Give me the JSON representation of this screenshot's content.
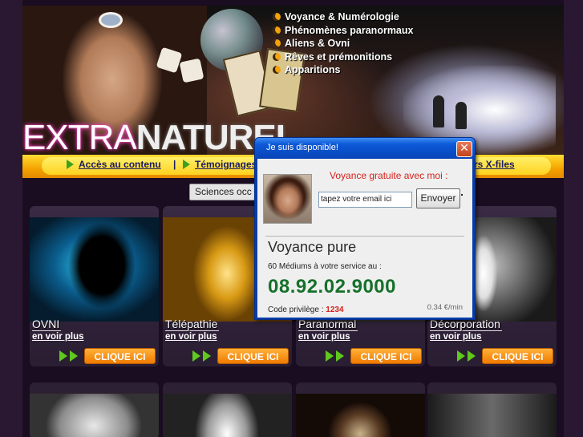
{
  "header": {
    "menu": [
      "Voyance & Numérologie",
      "Phénomènes paranormaux",
      "Aliens & Ovni",
      "Rêves et prémonitions",
      "Apparitions"
    ],
    "logo_part1": "EXTRA",
    "logo_part2": "NATUREL"
  },
  "nav": {
    "items": [
      "Accès au contenu",
      "Témoignages",
      "rs X-files"
    ],
    "separator": "|"
  },
  "category_select": {
    "value": "Sciences occ"
  },
  "cards": [
    {
      "title": "OVNI",
      "more": "en voir plus",
      "button": "CLIQUE ICI"
    },
    {
      "title": "Télépathie",
      "more": "en voir plus",
      "button": "CLIQUE ICI"
    },
    {
      "title": "Paranormal",
      "more": "en voir plus",
      "button": "CLIQUE ICI"
    },
    {
      "title": "Décorporation",
      "more": "en voir plus",
      "button": "CLIQUE ICI"
    }
  ],
  "popup": {
    "title": "Je suis disponible!",
    "close": "✕",
    "free_text": "Voyance gratuite avec moi :",
    "email_placeholder": "tapez votre email ici",
    "send_label": "Envoyer",
    "section_title": "Voyance pure",
    "mediums": "60 Médiums à votre service au :",
    "phone": "08.92.02.9000",
    "code_label": "Code privilège : ",
    "code_value": "1234",
    "price": "0.34 €/min"
  },
  "colors": {
    "accent_orange": "#f07a00",
    "nav_yellow": "#ffd21f",
    "phone_green": "#15712a",
    "alert_red": "#d4231d",
    "popup_blue": "#0c59d8"
  }
}
